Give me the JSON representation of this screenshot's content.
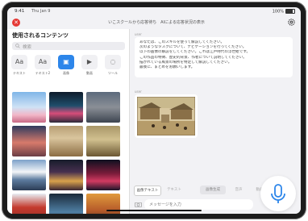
{
  "status": {
    "time": "9:41",
    "date": "Thu Jan 9",
    "battery": "100%"
  },
  "header": {
    "title": "いこスクールから応答待ち　AIによる応答状況の表示"
  },
  "sidebar": {
    "title": "使用されるコンテンツ",
    "search_placeholder": "検索",
    "types": [
      {
        "label": "テキスト",
        "glyph": "Aa"
      },
      {
        "label": "テキスト2",
        "glyph": "Aa"
      },
      {
        "label": "画像",
        "glyph": "▣"
      },
      {
        "label": "動画",
        "glyph": "▶"
      },
      {
        "label": "ツール",
        "glyph": "◌"
      }
    ]
  },
  "chat": {
    "user_label": "user",
    "user_lines": [
      "あなたは、このスキルを使って解説してください。",
      "次のようなタスクについて、ナビゲーションを行ってください。",
      "以下の画像の解説をしてください。これは江戸時代の浮世絵です。",
      "この作品の特徴、歴史的背景、作者について説明してください。",
      "描かれている風景の場所を特定して解説してください。",
      "最後に、まとめをお願いします。"
    ],
    "image_label": "user"
  },
  "toolbar": {
    "buttons": [
      "画像テキスト",
      "テキスト",
      "画像生成",
      "音声",
      "動画"
    ]
  },
  "input": {
    "placeholder": "メッセージを入力"
  },
  "colors": {
    "accent": "#2d86ea",
    "close": "#e53935"
  }
}
